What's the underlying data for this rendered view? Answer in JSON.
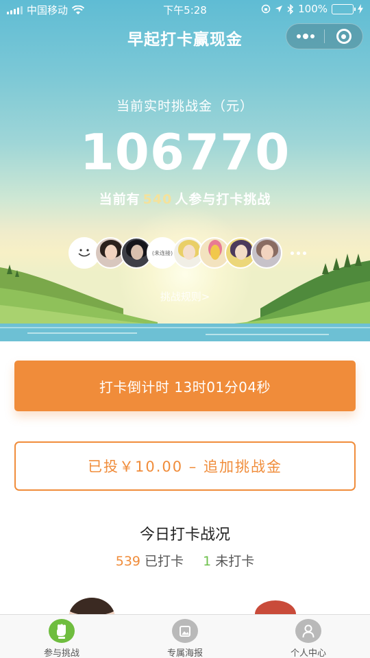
{
  "status_bar": {
    "carrier": "中国移动",
    "time": "下午5:28",
    "battery": "100%"
  },
  "nav": {
    "title": "早起打卡赢现金"
  },
  "hero": {
    "pool_label": "当前实时挑战金（元）",
    "pool_amount": "106770",
    "participants_prefix": "当前有",
    "participants_count": "540",
    "participants_suffix": "人参与打卡挑战",
    "rules_link": "挑战规则>"
  },
  "avatars": {
    "link_label": "(未连接)"
  },
  "countdown": {
    "label": "打卡倒计时 13时01分04秒"
  },
  "add_stake": {
    "label": "已投￥10.00 – 追加挑战金"
  },
  "stats": {
    "title": "今日打卡战况",
    "checked_in": "539",
    "checked_in_label": "已打卡",
    "not_checked": "1",
    "not_checked_label": "未打卡"
  },
  "tabbar": {
    "items": [
      {
        "label": "参与挑战",
        "icon": "fist-icon",
        "active": true
      },
      {
        "label": "专属海报",
        "icon": "poster-icon",
        "active": false
      },
      {
        "label": "个人中心",
        "icon": "person-icon",
        "active": false
      }
    ]
  },
  "colors": {
    "accent": "#f08c3a",
    "green": "#6cc04a",
    "count_highlight": "#f4e29c"
  }
}
